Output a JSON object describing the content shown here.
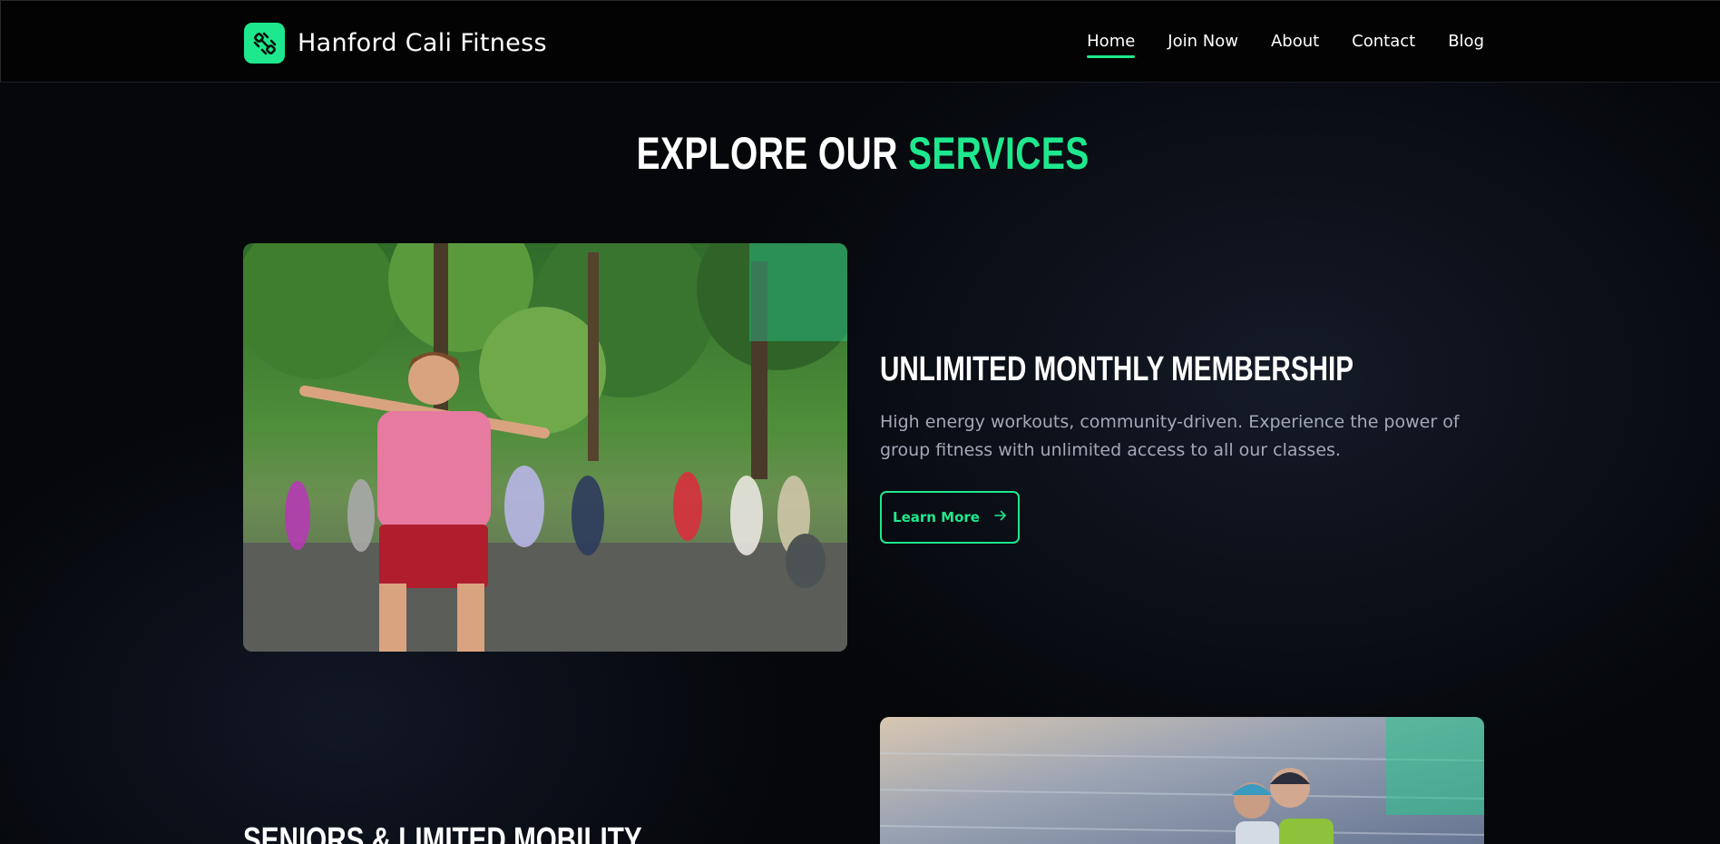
{
  "brand": {
    "name": "Hanford Cali Fitness",
    "logo_icon": "dumbbell-icon",
    "accent_color": "#1ee88d"
  },
  "nav": {
    "items": [
      {
        "label": "Home",
        "active": true
      },
      {
        "label": "Join Now",
        "active": false
      },
      {
        "label": "About",
        "active": false
      },
      {
        "label": "Contact",
        "active": false
      },
      {
        "label": "Blog",
        "active": false
      }
    ]
  },
  "section": {
    "title_prefix": "EXPLORE OUR ",
    "title_accent": "SERVICES"
  },
  "services": [
    {
      "title": "UNLIMITED MONTHLY MEMBERSHIP",
      "description": "High energy workouts, community-driven. Experience the power of group fitness with unlimited access to all our classes.",
      "button_label": "Learn More",
      "button_icon": "arrow-right-icon"
    },
    {
      "title": "SENIORS & LIMITED MOBILITY"
    }
  ]
}
